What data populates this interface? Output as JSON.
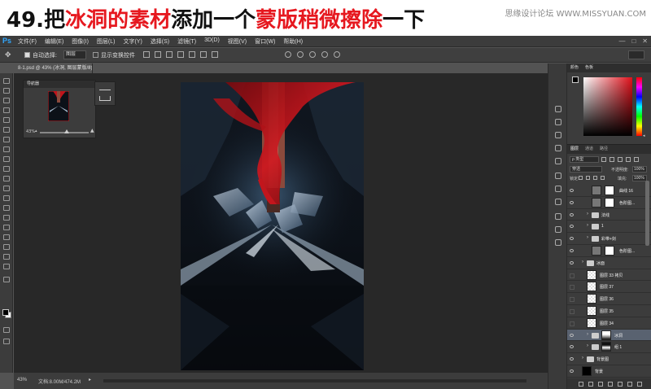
{
  "tutorial": {
    "step": "49.",
    "part1": "把",
    "part2": "冰洞的素材",
    "part3": "添加一个",
    "part4": "蒙版稍微擦除",
    "part5": "一下",
    "watermark": "思缘设计论坛 WWW.MISSYUAN.COM"
  },
  "app": {
    "logo": "Ps",
    "menus": [
      "文件(F)",
      "编辑(E)",
      "图像(I)",
      "图层(L)",
      "文字(Y)",
      "选择(S)",
      "滤镜(T)",
      "3D(D)",
      "视图(V)",
      "窗口(W)",
      "帮助(H)"
    ],
    "window_controls": [
      "—",
      "□",
      "✕"
    ]
  },
  "options": {
    "move_icon": "move-icon",
    "auto_select_label": "自动选择:",
    "auto_select_value": "图层",
    "show_transform_label": "显示变换控件"
  },
  "document": {
    "tab_title": "8-1.psd @ 43% (冰洞, 图层蒙版/8)",
    "close": "×",
    "zoom": "43%",
    "doc_size": "文档:8.00M/474.2M",
    "status_arrow": "▸"
  },
  "navigator": {
    "title": "导航器",
    "zoom": "43%"
  },
  "color_panel": {
    "tabs": [
      "颜色",
      "色板"
    ],
    "foreground": "#000000",
    "background": "#ffffff",
    "hue": "#e0101a"
  },
  "layers_panel": {
    "tabs": [
      "图层",
      "通道",
      "路径"
    ],
    "filter_label": "ρ 类型",
    "blend_mode": "穿透",
    "opacity_label": "不透明度:",
    "opacity": "100%",
    "lock_label": "锁定:",
    "fill_label": "填充:",
    "fill": "100%",
    "layers": [
      {
        "name": "曲线 16",
        "type": "adjustment",
        "visible": true,
        "indent": 2
      },
      {
        "name": "色阶图...",
        "type": "adjustment",
        "visible": true,
        "indent": 2
      },
      {
        "name": "法线",
        "type": "group",
        "visible": true,
        "indent": 1
      },
      {
        "name": "1",
        "type": "group",
        "visible": true,
        "indent": 1
      },
      {
        "name": "彩带+剑",
        "type": "group",
        "visible": true,
        "indent": 1
      },
      {
        "name": "色阶图...",
        "type": "adjustment",
        "visible": true,
        "indent": 2
      },
      {
        "name": "冰面",
        "type": "group",
        "visible": true,
        "indent": 0
      },
      {
        "name": "图层 33 拷贝",
        "type": "layer",
        "visible": false,
        "indent": 1
      },
      {
        "name": "图层 37",
        "type": "layer",
        "visible": false,
        "indent": 1
      },
      {
        "name": "图层 36",
        "type": "layer",
        "visible": false,
        "indent": 1
      },
      {
        "name": "图层 35",
        "type": "layer",
        "visible": false,
        "indent": 1
      },
      {
        "name": "图层 34",
        "type": "layer",
        "visible": false,
        "indent": 1
      },
      {
        "name": "冰洞",
        "type": "group-mask",
        "visible": true,
        "indent": 1,
        "selected": true
      },
      {
        "name": "组 1",
        "type": "group-mask",
        "visible": true,
        "indent": 1
      },
      {
        "name": "背景图",
        "type": "group",
        "visible": true,
        "indent": 0
      },
      {
        "name": "背景",
        "type": "layer",
        "visible": true,
        "indent": 0
      }
    ]
  }
}
